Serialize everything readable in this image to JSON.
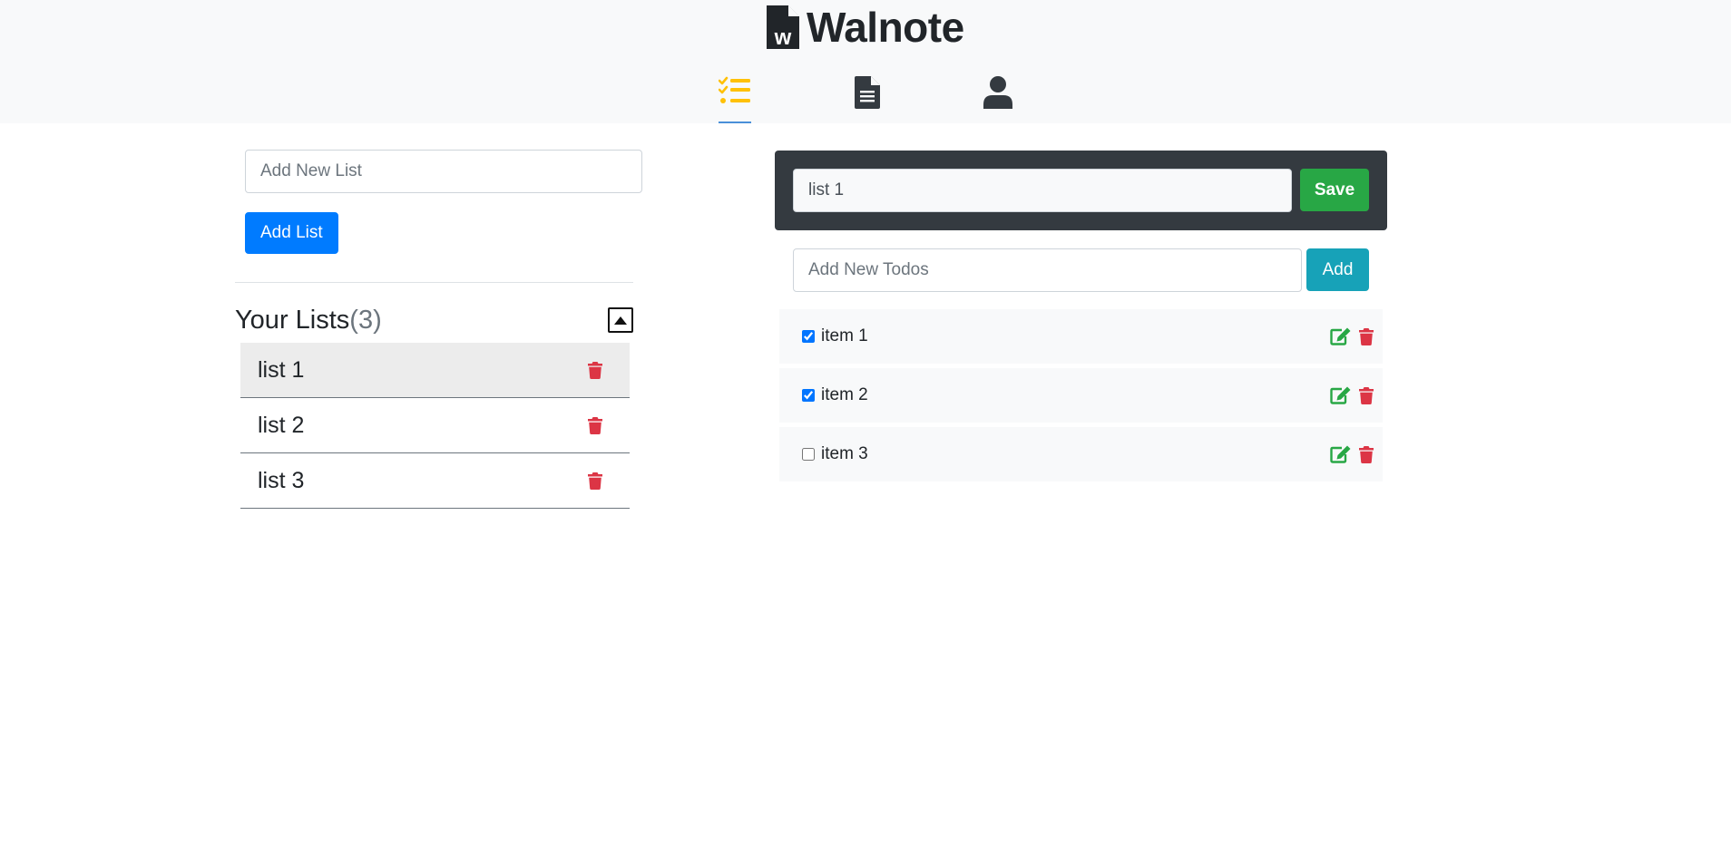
{
  "app": {
    "brand_name": "Walnote",
    "logo_letter": "w"
  },
  "nav": {
    "tabs": [
      {
        "icon": "tasks-icon",
        "active": true,
        "color": "#ffc107"
      },
      {
        "icon": "document-icon",
        "active": false,
        "color": "#343a40"
      },
      {
        "icon": "user-icon",
        "active": false,
        "color": "#343a40"
      }
    ]
  },
  "sidebar": {
    "new_list_placeholder": "Add New List",
    "add_list_label": "Add List",
    "lists_title": "Your Lists",
    "lists_count": "(3)",
    "lists": [
      {
        "label": "list 1",
        "selected": true
      },
      {
        "label": "list 2",
        "selected": false
      },
      {
        "label": "list 3",
        "selected": false
      }
    ]
  },
  "editor": {
    "title_value": "list 1",
    "save_label": "Save",
    "todo_placeholder": "Add New Todos",
    "add_label": "Add",
    "todos": [
      {
        "label": "item 1",
        "checked": true
      },
      {
        "label": "item 2",
        "checked": true
      },
      {
        "label": "item 3",
        "checked": false
      }
    ]
  },
  "colors": {
    "primary": "#007bff",
    "success": "#28a745",
    "info": "#17a2b8",
    "danger": "#dc3545",
    "dark": "#343a40",
    "warning": "#ffc107"
  }
}
